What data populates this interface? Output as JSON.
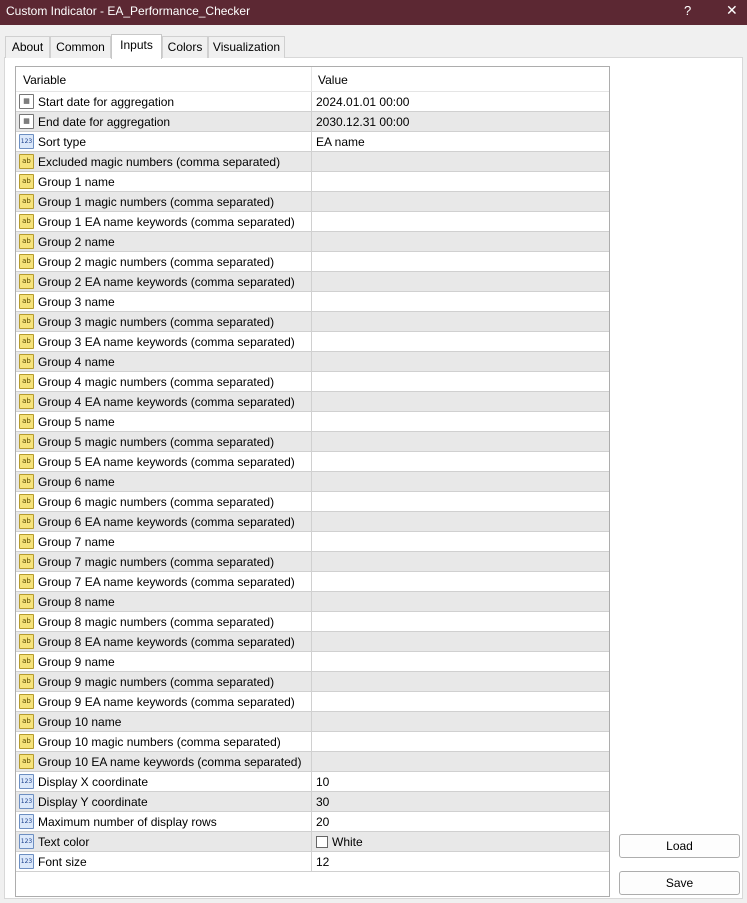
{
  "window": {
    "title": "Custom Indicator - EA_Performance_Checker",
    "help": "?",
    "close": "✕"
  },
  "tabs": [
    "About",
    "Common",
    "Inputs",
    "Colors",
    "Visualization"
  ],
  "grid": {
    "headers": {
      "variable": "Variable",
      "value": "Value"
    },
    "rows": [
      {
        "icon": "date",
        "name": "Start date for aggregation",
        "value": "2024.01.01 00:00"
      },
      {
        "icon": "date",
        "name": "End date for aggregation",
        "value": "2030.12.31 00:00"
      },
      {
        "icon": "num",
        "name": "Sort type",
        "value": "EA name"
      },
      {
        "icon": "ab",
        "name": "Excluded magic numbers (comma separated)",
        "value": ""
      },
      {
        "icon": "ab",
        "name": "Group 1 name",
        "value": ""
      },
      {
        "icon": "ab",
        "name": "Group 1 magic numbers (comma separated)",
        "value": ""
      },
      {
        "icon": "ab",
        "name": "Group 1 EA name keywords (comma separated)",
        "value": ""
      },
      {
        "icon": "ab",
        "name": "Group 2 name",
        "value": ""
      },
      {
        "icon": "ab",
        "name": "Group 2 magic numbers (comma separated)",
        "value": ""
      },
      {
        "icon": "ab",
        "name": "Group 2 EA name keywords (comma separated)",
        "value": ""
      },
      {
        "icon": "ab",
        "name": "Group 3 name",
        "value": ""
      },
      {
        "icon": "ab",
        "name": "Group 3 magic numbers (comma separated)",
        "value": ""
      },
      {
        "icon": "ab",
        "name": "Group 3 EA name keywords (comma separated)",
        "value": ""
      },
      {
        "icon": "ab",
        "name": "Group 4 name",
        "value": ""
      },
      {
        "icon": "ab",
        "name": "Group 4 magic numbers (comma separated)",
        "value": ""
      },
      {
        "icon": "ab",
        "name": "Group 4 EA name keywords (comma separated)",
        "value": ""
      },
      {
        "icon": "ab",
        "name": "Group 5 name",
        "value": ""
      },
      {
        "icon": "ab",
        "name": "Group 5 magic numbers (comma separated)",
        "value": ""
      },
      {
        "icon": "ab",
        "name": "Group 5 EA name keywords (comma separated)",
        "value": ""
      },
      {
        "icon": "ab",
        "name": "Group 6 name",
        "value": ""
      },
      {
        "icon": "ab",
        "name": "Group 6 magic numbers (comma separated)",
        "value": ""
      },
      {
        "icon": "ab",
        "name": "Group 6 EA name keywords (comma separated)",
        "value": ""
      },
      {
        "icon": "ab",
        "name": "Group 7 name",
        "value": ""
      },
      {
        "icon": "ab",
        "name": "Group 7 magic numbers (comma separated)",
        "value": ""
      },
      {
        "icon": "ab",
        "name": "Group 7 EA name keywords (comma separated)",
        "value": ""
      },
      {
        "icon": "ab",
        "name": "Group 8 name",
        "value": ""
      },
      {
        "icon": "ab",
        "name": "Group 8 magic numbers (comma separated)",
        "value": ""
      },
      {
        "icon": "ab",
        "name": "Group 8 EA name keywords (comma separated)",
        "value": ""
      },
      {
        "icon": "ab",
        "name": "Group 9 name",
        "value": ""
      },
      {
        "icon": "ab",
        "name": "Group 9 magic numbers (comma separated)",
        "value": ""
      },
      {
        "icon": "ab",
        "name": "Group 9 EA name keywords (comma separated)",
        "value": ""
      },
      {
        "icon": "ab",
        "name": "Group 10 name",
        "value": ""
      },
      {
        "icon": "ab",
        "name": "Group 10 magic numbers (comma separated)",
        "value": ""
      },
      {
        "icon": "ab",
        "name": "Group 10 EA name keywords (comma separated)",
        "value": ""
      },
      {
        "icon": "num",
        "name": "Display X coordinate",
        "value": "10"
      },
      {
        "icon": "num",
        "name": "Display Y coordinate",
        "value": "30"
      },
      {
        "icon": "num",
        "name": "Maximum number of display rows",
        "value": "20"
      },
      {
        "icon": "num",
        "name": "Text color",
        "value": "White",
        "swatch": true
      },
      {
        "icon": "num",
        "name": "Font size",
        "value": "12"
      }
    ]
  },
  "buttons": {
    "load": "Load",
    "save": "Save"
  },
  "colors": {
    "titlebar": "#5c2833",
    "row_alt": "#e8e8e8"
  }
}
